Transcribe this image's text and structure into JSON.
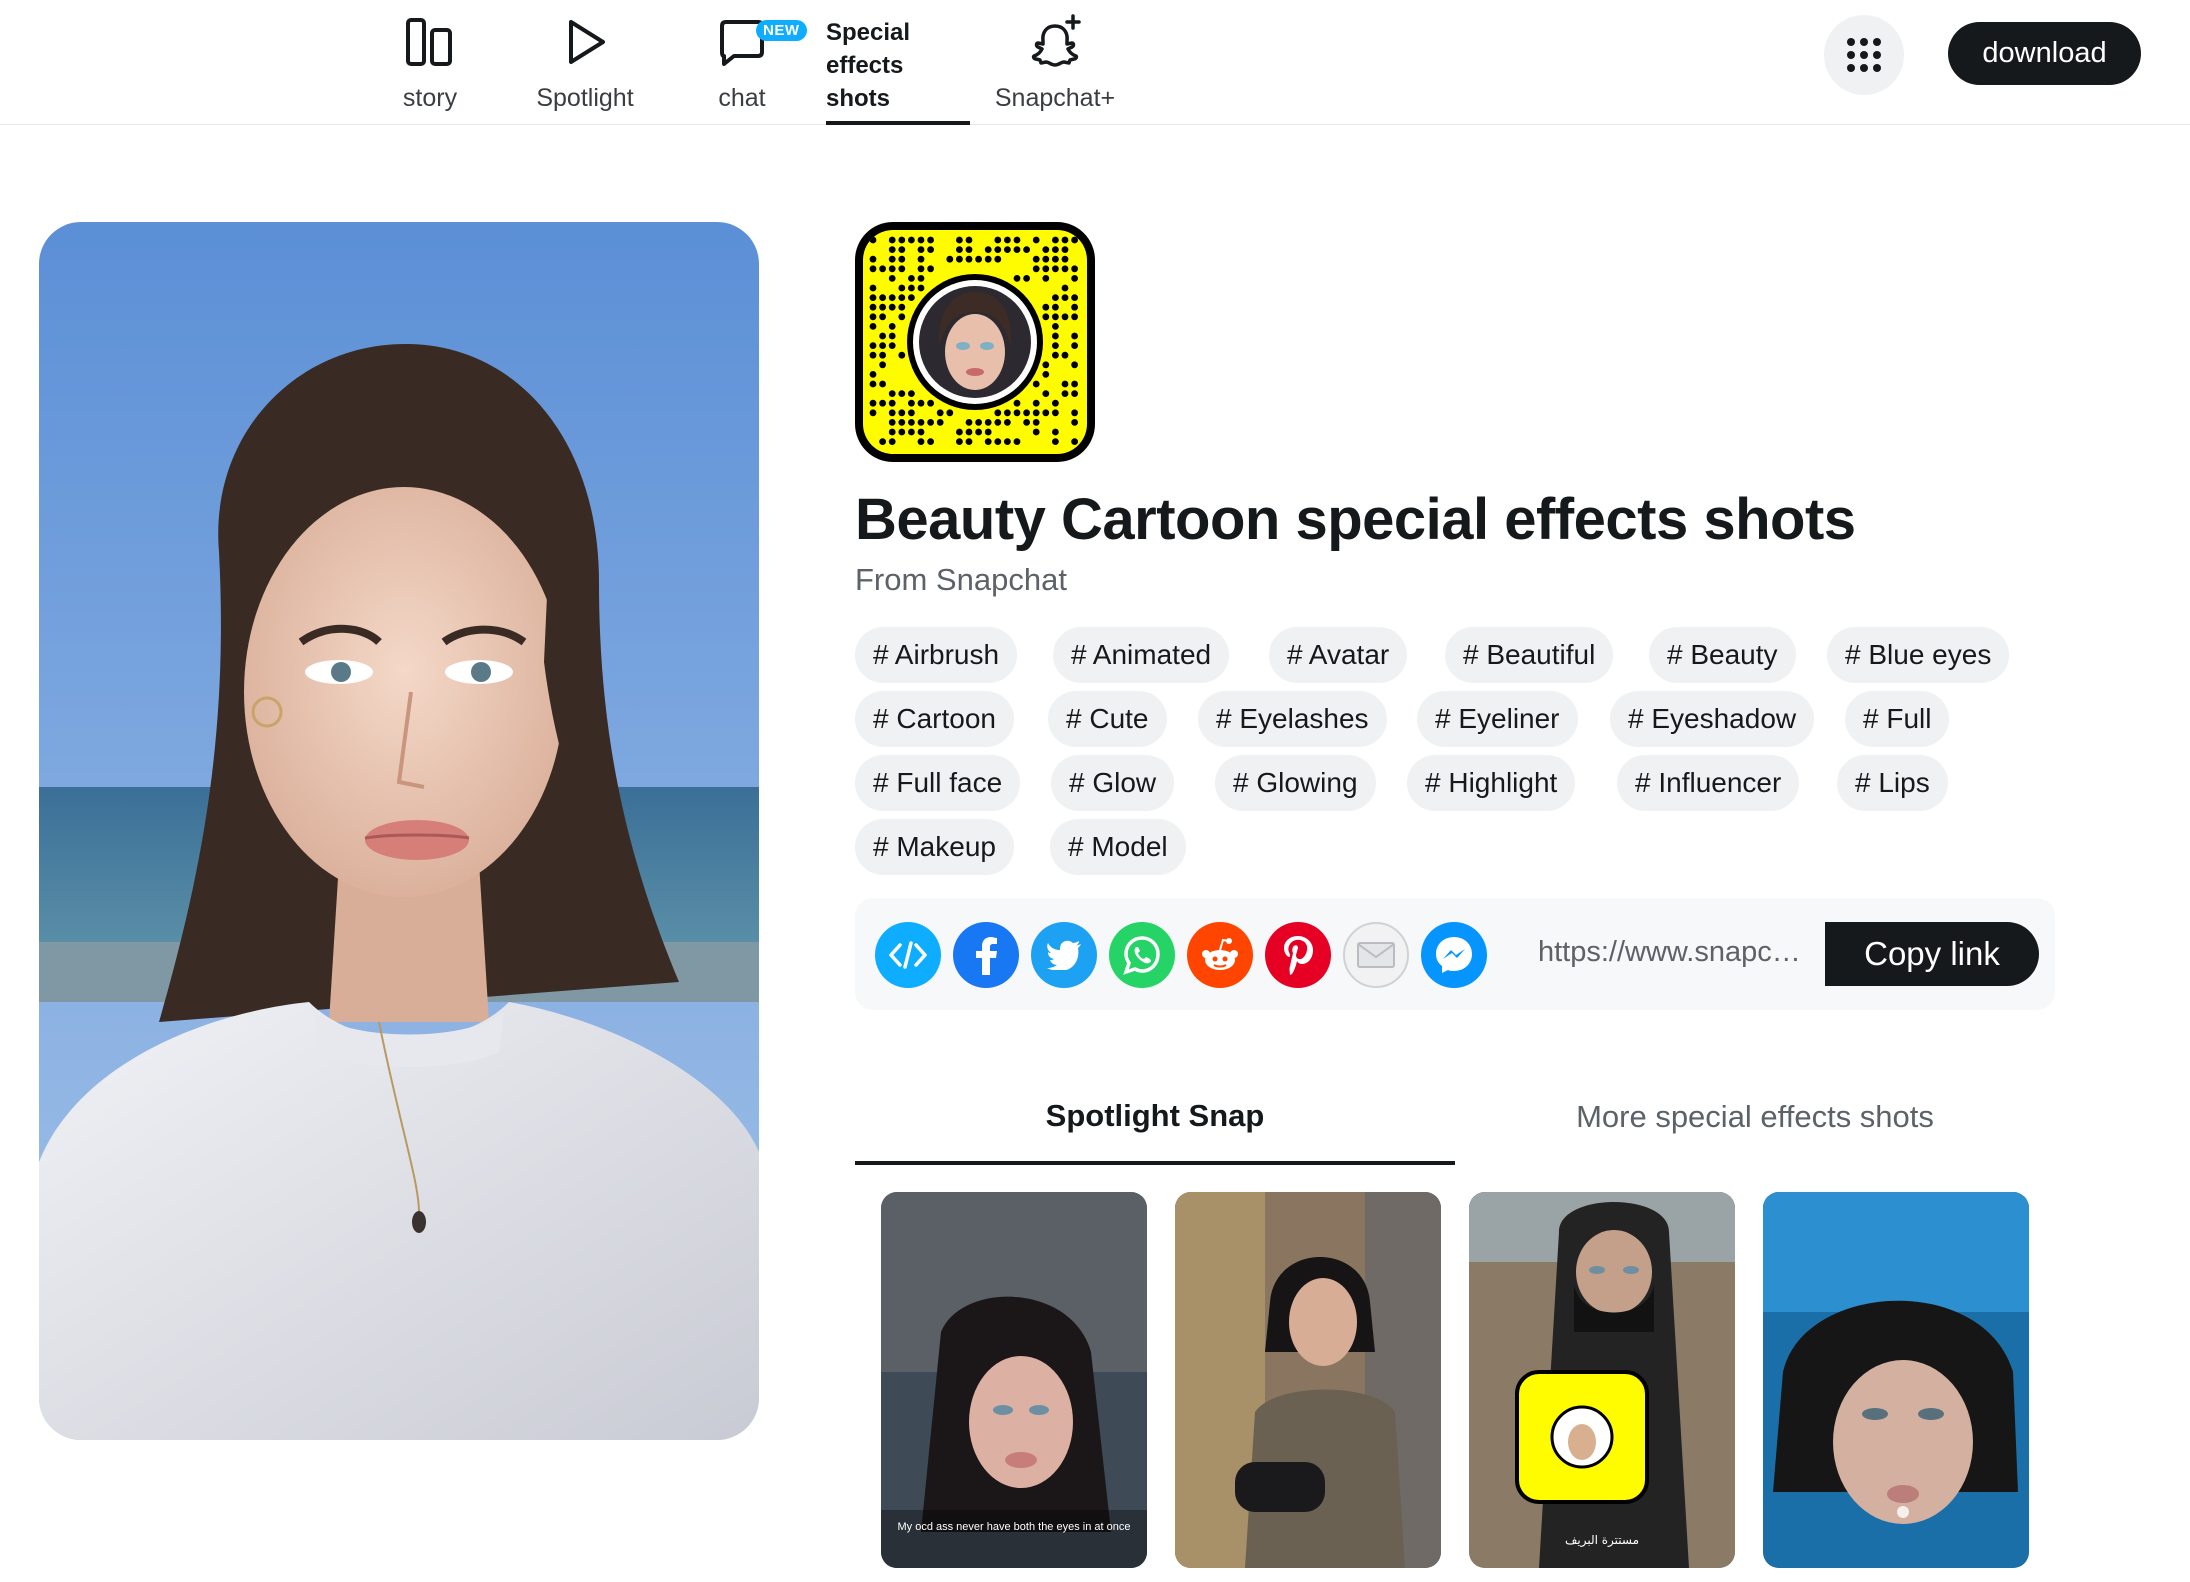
{
  "nav": {
    "items": [
      {
        "label": "story",
        "icon": "stories-icon"
      },
      {
        "label": "Spotlight",
        "icon": "play-icon"
      },
      {
        "label": "chat",
        "icon": "chat-icon",
        "badge": "NEW"
      },
      {
        "label": "Special effects shots",
        "lines": [
          "Special",
          "effects",
          "shots"
        ],
        "active": true
      },
      {
        "label": "Snapchat+",
        "icon": "snapchat-plus-icon"
      }
    ],
    "download_label": "download"
  },
  "lens": {
    "title": "Beauty Cartoon special effects shots",
    "from": "From Snapchat",
    "tags": [
      "# Airbrush",
      "# Animated",
      "# Avatar",
      "# Beautiful",
      "# Beauty",
      "# Blue eyes",
      "# Cartoon",
      "# Cute",
      "# Eyelashes",
      "# Eyeliner",
      "# Eyeshadow",
      "# Full",
      "# Full face",
      "# Glow",
      "# Glowing",
      "# Highlight",
      "# Influencer",
      "# Lips",
      "# Makeup",
      "# Model"
    ]
  },
  "share": {
    "url": "https://www.snapchat.com/lens/...",
    "copy_label": "Copy link",
    "icons": [
      "embed-icon",
      "facebook-icon",
      "twitter-icon",
      "whatsapp-icon",
      "reddit-icon",
      "pinterest-icon",
      "email-icon",
      "messenger-icon"
    ]
  },
  "tabs": {
    "spotlight": "Spotlight Snap",
    "more": "More special effects shots"
  },
  "thumbnails": [
    {
      "caption": "My ocd ass never have both the eyes in at once"
    },
    {
      "caption": ""
    },
    {
      "caption": "مستترة البريف"
    },
    {
      "caption": ""
    }
  ],
  "colors": {
    "snap_yellow": "#FFFC00",
    "dark": "#16191C",
    "chip_bg": "#F0F1F2"
  }
}
